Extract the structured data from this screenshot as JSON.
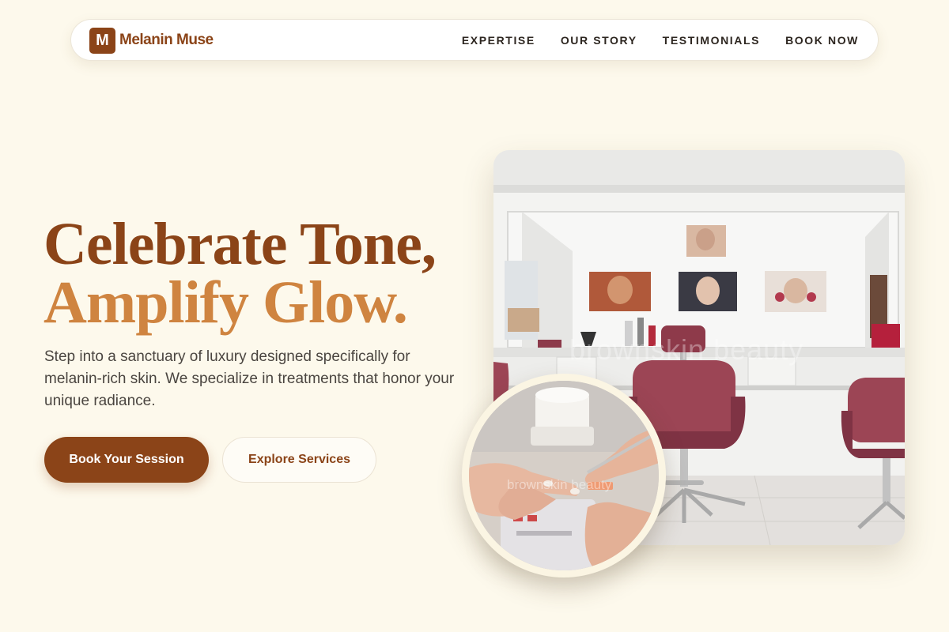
{
  "brand": {
    "badge": "M",
    "name": "Melanin Muse"
  },
  "nav": {
    "links": [
      "EXPERTISE",
      "OUR STORY",
      "TESTIMONIALS",
      "BOOK NOW"
    ]
  },
  "hero": {
    "headline_line1": "Celebrate Tone,",
    "headline_line2": "Amplify Glow.",
    "subtext": "Step into a sanctuary of luxury designed specifically for melanin-rich skin. We specialize in treatments that honor your unique radiance.",
    "primary_cta": "Book Your Session",
    "secondary_cta": "Explore Services"
  },
  "images": {
    "salon_watermark": "brownskin beauty",
    "manicure_watermark": "brownskin beauty"
  },
  "colors": {
    "background": "#fdf9ec",
    "brand_brown": "#8b4418",
    "accent_orange": "#cf8440",
    "text_dark": "#2d2620"
  }
}
